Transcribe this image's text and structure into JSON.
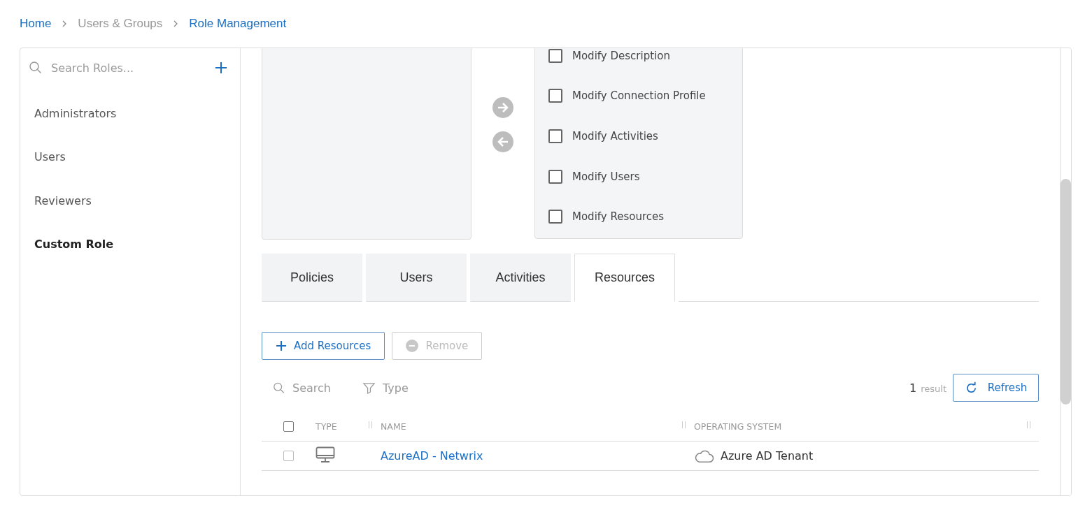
{
  "breadcrumb": [
    {
      "label": "Home",
      "kind": "link"
    },
    {
      "label": "Users & Groups",
      "kind": "muted"
    },
    {
      "label": "Role Management",
      "kind": "link"
    }
  ],
  "sidebar": {
    "search": {
      "placeholder": "Search Roles..."
    },
    "items": [
      {
        "label": "Administrators",
        "selected": false
      },
      {
        "label": "Users",
        "selected": false
      },
      {
        "label": "Reviewers",
        "selected": false
      },
      {
        "label": "Custom Role",
        "selected": true
      }
    ]
  },
  "permissions": [
    {
      "label": "Modify Description",
      "checked": false
    },
    {
      "label": "Modify Connection Profile",
      "checked": false
    },
    {
      "label": "Modify Activities",
      "checked": false
    },
    {
      "label": "Modify Users",
      "checked": false
    },
    {
      "label": "Modify Resources",
      "checked": false
    }
  ],
  "tabs": [
    {
      "label": "Policies",
      "selected": false
    },
    {
      "label": "Users",
      "selected": false
    },
    {
      "label": "Activities",
      "selected": false
    },
    {
      "label": "Resources",
      "selected": true
    }
  ],
  "actions": [
    {
      "label": "Add Resources",
      "disabled": false
    },
    {
      "label": "Remove",
      "disabled": true
    }
  ],
  "filters": {
    "search": {
      "placeholder": "Search"
    },
    "type": "Type"
  },
  "result_count": {
    "count": "1",
    "label": "result"
  },
  "refresh": "Refresh",
  "table": {
    "select_all": {
      "checked": false
    },
    "columns": [
      "TYPE",
      "NAME",
      "OPERATING SYSTEM"
    ],
    "rows": [
      {
        "checked": false,
        "name": "AzureAD - Netwrix",
        "os": "Azure AD Tenant"
      }
    ]
  }
}
